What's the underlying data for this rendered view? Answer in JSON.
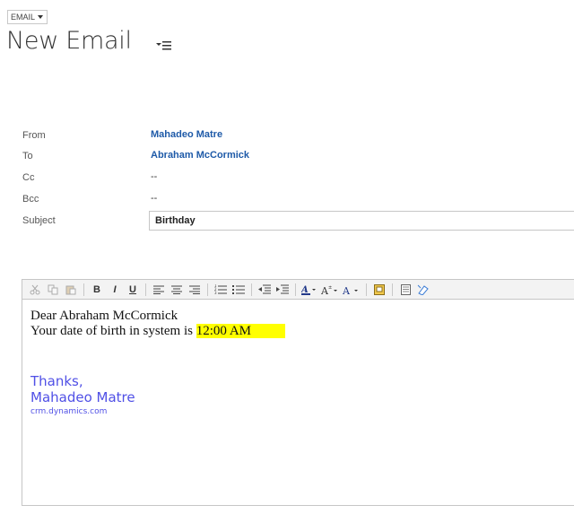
{
  "header": {
    "entity_label": "EMAIL",
    "title": "New Email"
  },
  "fields": {
    "from_label": "From",
    "from_value": "Mahadeo Matre",
    "to_label": "To",
    "to_value": "Abraham McCormick",
    "cc_label": "Cc",
    "cc_value": "--",
    "bcc_label": "Bcc",
    "bcc_value": "--",
    "subject_label": "Subject",
    "subject_value": "Birthday"
  },
  "toolbar": {
    "buttons": [
      "cut-icon",
      "copy-icon",
      "paste-icon",
      "bold-icon",
      "italic-icon",
      "underline-icon",
      "align-left-icon",
      "align-center-icon",
      "align-right-icon",
      "numbered-list-icon",
      "bulleted-list-icon",
      "decrease-indent-icon",
      "increase-indent-icon",
      "highlight-color-icon",
      "font-size-icon",
      "font-color-icon",
      "insert-image-icon",
      "html-source-icon",
      "clear-format-icon"
    ],
    "bold": "B",
    "italic": "I",
    "underline": "U"
  },
  "body": {
    "greeting": "Dear Abraham McCormick",
    "line_prefix": "Your date of birth in system is ",
    "dob_value": "12:00 AM",
    "sig_thanks": "Thanks,",
    "sig_name": "Mahadeo Matre",
    "sig_site": "crm.dynamics.com"
  },
  "colors": {
    "link": "#1e5aa8",
    "signature": "#5050e6",
    "highlight": "#ffff00"
  }
}
